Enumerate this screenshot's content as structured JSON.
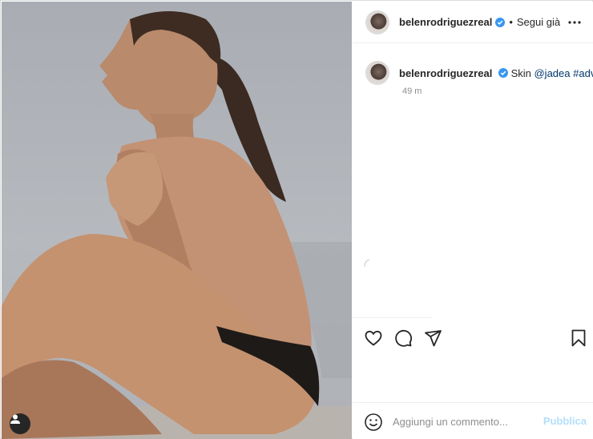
{
  "post": {
    "username": "belenrodriguezreal",
    "follow_separator": "•",
    "follow_label": "Segui già",
    "more_icon": "more-options-icon",
    "verified_color": "#3897f0"
  },
  "caption": {
    "username": "belenrodriguezreal",
    "text": "Skin",
    "mention": "@jadea",
    "hashtag": "#adv",
    "time": "49 m"
  },
  "actions": {
    "icons": [
      "heart-icon",
      "comment-icon",
      "share-icon",
      "bookmark-icon"
    ]
  },
  "comment": {
    "placeholder": "Aggiungi un commento...",
    "publish_label": "Pubblica",
    "publish_color": "#b2dffc"
  }
}
